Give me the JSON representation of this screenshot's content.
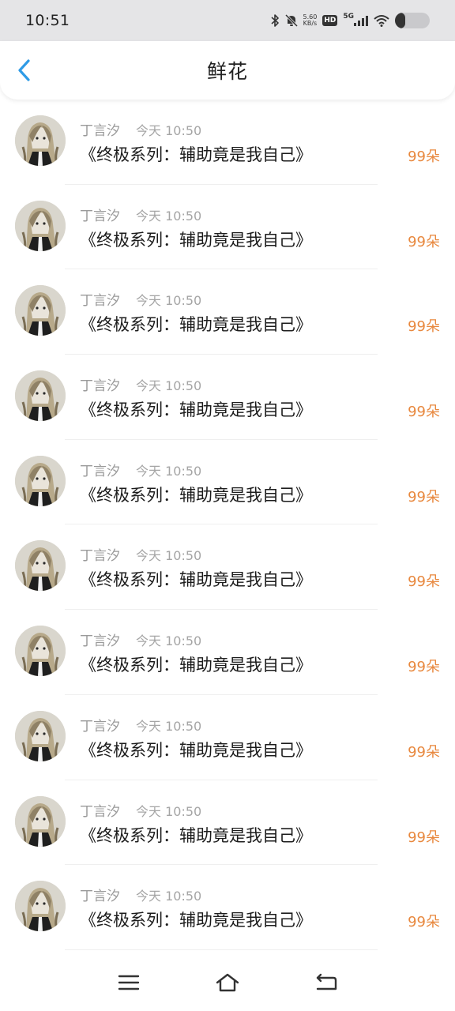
{
  "status_bar": {
    "time": "10:51",
    "net_speed_value": "5.60",
    "net_speed_unit": "KB/s",
    "hd_label": "HD",
    "network_label": "5G",
    "icons": [
      "bluetooth-icon",
      "mute-icon",
      "signal-icon",
      "wifi-icon",
      "battery-icon"
    ],
    "battery_level": 0.3
  },
  "header": {
    "title": "鲜花",
    "back_icon": "chevron-left-icon",
    "accent_color": "#2f9be6"
  },
  "list": {
    "count_color": "#e8883e",
    "items": [
      {
        "name": "丁言汐",
        "time": "今天 10:50",
        "title": "《终极系列：辅助竟是我自己》",
        "count": "99朵"
      },
      {
        "name": "丁言汐",
        "time": "今天 10:50",
        "title": "《终极系列：辅助竟是我自己》",
        "count": "99朵"
      },
      {
        "name": "丁言汐",
        "time": "今天 10:50",
        "title": "《终极系列：辅助竟是我自己》",
        "count": "99朵"
      },
      {
        "name": "丁言汐",
        "time": "今天 10:50",
        "title": "《终极系列：辅助竟是我自己》",
        "count": "99朵"
      },
      {
        "name": "丁言汐",
        "time": "今天 10:50",
        "title": "《终极系列：辅助竟是我自己》",
        "count": "99朵"
      },
      {
        "name": "丁言汐",
        "time": "今天 10:50",
        "title": "《终极系列：辅助竟是我自己》",
        "count": "99朵"
      },
      {
        "name": "丁言汐",
        "time": "今天 10:50",
        "title": "《终极系列：辅助竟是我自己》",
        "count": "99朵"
      },
      {
        "name": "丁言汐",
        "time": "今天 10:50",
        "title": "《终极系列：辅助竟是我自己》",
        "count": "99朵"
      },
      {
        "name": "丁言汐",
        "time": "今天 10:50",
        "title": "《终极系列：辅助竟是我自己》",
        "count": "99朵"
      },
      {
        "name": "丁言汐",
        "time": "今天 10:50",
        "title": "《终极系列：辅助竟是我自己》",
        "count": "99朵"
      }
    ]
  },
  "nav_bar": {
    "icons": [
      "menu-icon",
      "home-icon",
      "back-icon"
    ]
  }
}
